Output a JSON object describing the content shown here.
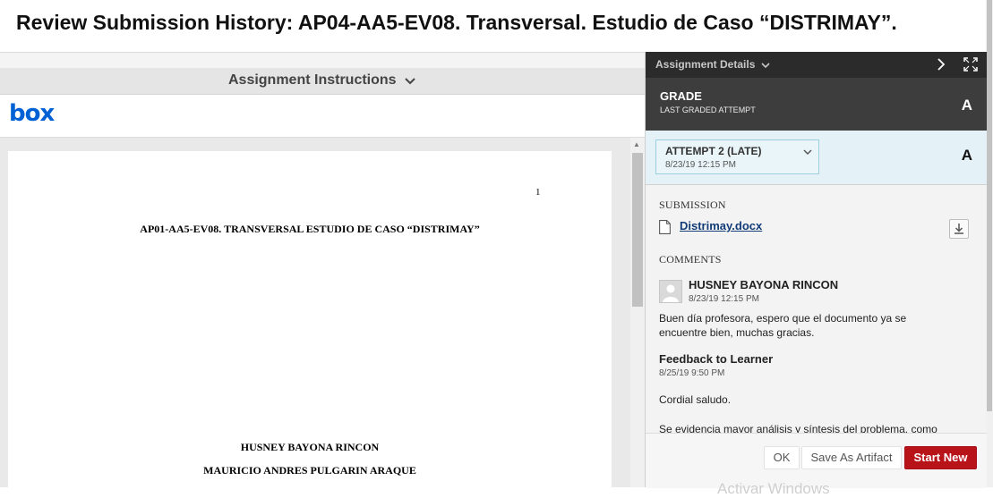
{
  "page": {
    "title": "Review Submission History: AP04-AA5-EV08. Transversal. Estudio de Caso “DISTRIMAY”."
  },
  "left_pane": {
    "instructions_label": "Assignment Instructions",
    "box_logo_text": "box",
    "document": {
      "page_number": "1",
      "title": "AP01-AA5-EV08. TRANSVERSAL ESTUDIO DE CASO “DISTRIMAY”",
      "authors": [
        "HUSNEY BAYONA RINCON",
        "MAURICIO ANDRES PULGARIN ARAQUE"
      ]
    }
  },
  "right_pane": {
    "header_label": "Assignment Details",
    "grade": {
      "label": "GRADE",
      "sublabel": "LAST GRADED ATTEMPT",
      "value": "A"
    },
    "attempt": {
      "label": "ATTEMPT 2 (LATE)",
      "date": "8/23/19 12:15 PM",
      "grade": "A"
    },
    "submission": {
      "heading": "SUBMISSION",
      "file_name": "Distrimay.docx"
    },
    "comments": {
      "heading": "COMMENTS",
      "author": "HUSNEY BAYONA RINCON",
      "date": "8/23/19 12:15 PM",
      "text": "Buen día profesora, espero que el documento ya se encuentre bien, muchas gracias."
    },
    "feedback": {
      "title": "Feedback to Learner",
      "date": "8/25/19 9:50 PM",
      "greeting": "Cordial saludo.",
      "partial_text": "Se evidencia mayor análisis y síntesis del problema, como"
    },
    "actions": {
      "ok_label": "OK",
      "save_label": "Save As Artifact",
      "start_new_label": "Start New"
    },
    "watermark": "Activar Windows"
  },
  "icons": {
    "chevron_down": "chevron-down-icon",
    "chevron_right": "chevron-right-icon",
    "expand": "expand-icon",
    "file": "file-icon",
    "download": "download-icon",
    "avatar": "user-avatar-icon"
  },
  "colors": {
    "header_dark": "#2b2b2b",
    "grade_panel": "#3d3d3d",
    "attempt_band": "#e4f1f7",
    "primary_button": "#b9131a",
    "link": "#123c78",
    "box_brand": "#0061d5"
  }
}
